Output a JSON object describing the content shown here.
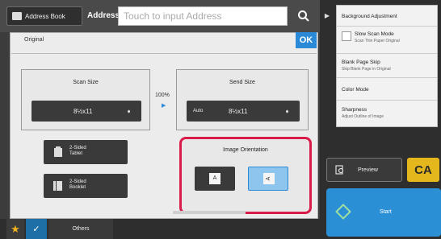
{
  "header": {
    "address_book_label": "Address Book",
    "address_label": "Address",
    "address_placeholder": "Touch to input Address"
  },
  "dialog": {
    "title": "Original",
    "ok_label": "OK",
    "scan_size": {
      "title": "Scan Size",
      "value": "8½x11"
    },
    "ratio": "100%",
    "send_size": {
      "title": "Send Size",
      "auto_label": "Auto",
      "value": "8½x11"
    },
    "two_sided_tablet": "2-Sided\nTablet",
    "two_sided_booklet": "2-Sided\nBooklet",
    "image_orientation": {
      "title": "Image Orientation",
      "options": [
        "A",
        "A"
      ],
      "selected_index": 1
    }
  },
  "right_panel": {
    "settings": [
      {
        "label": "Background Adjustment",
        "sub": ""
      },
      {
        "label": "Slow Scan Mode",
        "sub": "Scan Thin Paper Original"
      },
      {
        "label": "Blank Page Skip",
        "sub": "Skip Blank Page in Original"
      },
      {
        "label": "Color Mode",
        "sub": ""
      },
      {
        "label": "Sharpness",
        "sub": "Adjust Outline of Image"
      }
    ],
    "preview_label": "Preview",
    "ca_label": "CA",
    "start_label": "Start"
  },
  "bottom_bar": {
    "others_label": "Others"
  },
  "colors": {
    "accent": "#2a8ad8",
    "highlight": "#d91c4a",
    "ca": "#e4b81c",
    "start": "#2b8fd6"
  }
}
